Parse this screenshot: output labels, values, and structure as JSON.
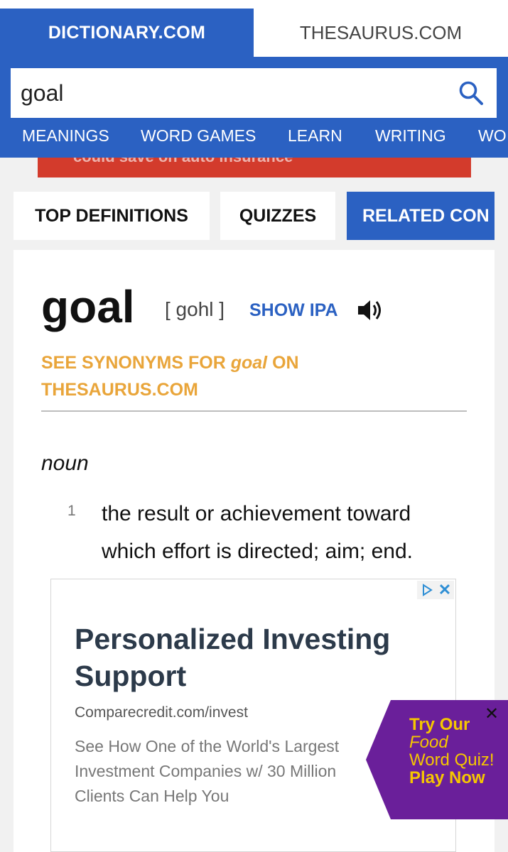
{
  "header": {
    "dictionary_tab": "DICTIONARY.COM",
    "thesaurus_tab": "THESAURUS.COM",
    "search_value": "goal",
    "nav": [
      "MEANINGS",
      "WORD GAMES",
      "LEARN",
      "WRITING",
      "WO"
    ]
  },
  "banner": {
    "partial_text": "could save on auto insurance"
  },
  "tabs": {
    "top_definitions": "TOP DEFINITIONS",
    "quizzes": "QUIZZES",
    "related": "RELATED CON"
  },
  "entry": {
    "headword": "goal",
    "pronunciation": "[ gohl ]",
    "show_ipa": "SHOW IPA",
    "synonyms_prefix": "SEE SYNONYMS FOR ",
    "synonyms_word": "goal",
    "synonyms_suffix": " ON THESAURUS.COM",
    "part_of_speech": "noun",
    "definition_number": "1",
    "definition": "the result or achievement toward which effort is directed; aim; end."
  },
  "ad": {
    "title": "Personalized Investing Support",
    "url": "Comparecredit.com/invest",
    "description": "See How One of the World's Largest Investment Companies w/ 30 Million Clients Can Help You",
    "close": "✕"
  },
  "promo": {
    "try_our": "Try Our",
    "food": "Food",
    "word_quiz": "Word Quiz!",
    "play_now": "Play Now",
    "close": "✕"
  },
  "colors": {
    "brand_blue": "#2b61c2",
    "synonym_orange": "#e9a53a",
    "promo_purple": "#6a1f9a",
    "promo_yellow": "#f6c700",
    "banner_red": "#d33b2c"
  },
  "icons": {
    "search": "search-icon",
    "speaker": "speaker-icon",
    "ad_choices": "ad-choices-icon",
    "close": "close-icon"
  }
}
